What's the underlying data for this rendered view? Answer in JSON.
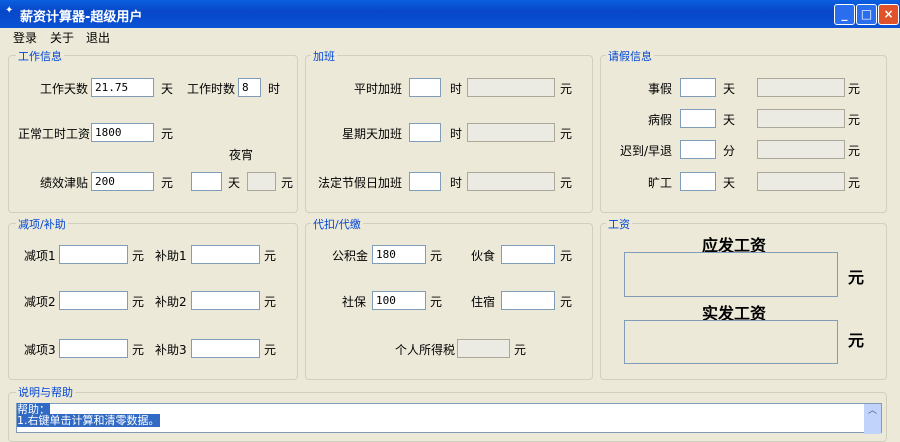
{
  "window": {
    "title": "薪资计算器-超级用户",
    "min": "_",
    "max": "□",
    "close": "×"
  },
  "menu": [
    "登录",
    "关于",
    "退出"
  ],
  "work": {
    "legend": "工作信息",
    "days_label": "工作天数",
    "days": "21.75",
    "day_unit": "天",
    "hours_label": "工作时数",
    "hours": "8",
    "hour_unit": "时",
    "wage_label": "正常工时工资",
    "wage": "1800",
    "yuan": "元",
    "night_label": "夜宵",
    "bonus_label": "绩效津贴",
    "bonus": "200",
    "night_days": "",
    "night_unit": "天",
    "night_amount": ""
  },
  "overtime": {
    "legend": "加班",
    "rows": [
      {
        "label": "平时加班",
        "unit": "时",
        "yuan": "元"
      },
      {
        "label": "星期天加班",
        "unit": "时",
        "yuan": "元"
      },
      {
        "label": "法定节假日加班",
        "unit": "时",
        "yuan": "元"
      }
    ]
  },
  "leave": {
    "legend": "请假信息",
    "rows": [
      {
        "label": "事假",
        "unit": "天",
        "yuan": "元"
      },
      {
        "label": "病假",
        "unit": "天",
        "yuan": "元"
      },
      {
        "label": "迟到/早退",
        "unit": "分",
        "yuan": "元"
      },
      {
        "label": "旷工",
        "unit": "天",
        "yuan": "元"
      }
    ]
  },
  "deduct": {
    "legend": "减项/补助",
    "rows": [
      {
        "d": "减项1",
        "s": "补助1"
      },
      {
        "d": "减项2",
        "s": "补助2"
      },
      {
        "d": "减项3",
        "s": "补助3"
      }
    ],
    "yuan": "元"
  },
  "withhold": {
    "legend": "代扣/代缴",
    "fund_label": "公积金",
    "fund": "180",
    "meal_label": "伙食",
    "ins_label": "社保",
    "ins": "100",
    "room_label": "住宿",
    "tax_label": "个人所得税",
    "yuan": "元"
  },
  "salary": {
    "legend": "工资",
    "gross": "应发工资",
    "net": "实发工资",
    "yuan": "元"
  },
  "help": {
    "legend": "说明与帮助",
    "lines": [
      "帮助：",
      "1.右键单击计算和清零数据。"
    ]
  }
}
